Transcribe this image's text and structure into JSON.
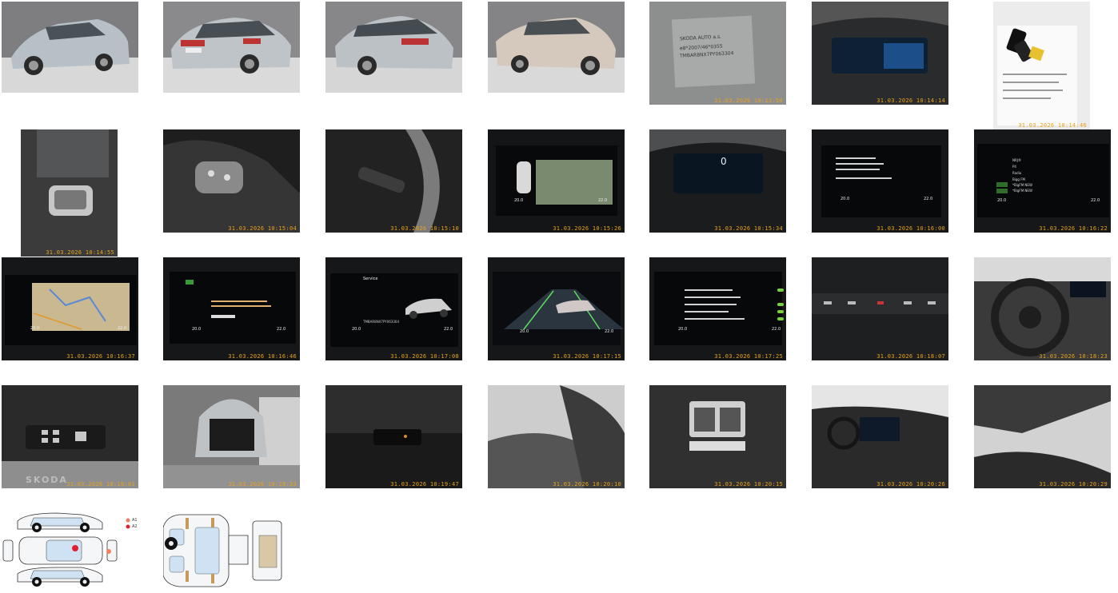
{
  "gallery": {
    "photos": [
      {
        "name": "exterior-front-left-photo",
        "stamp": ""
      },
      {
        "name": "exterior-rear-left-photo",
        "stamp": ""
      },
      {
        "name": "exterior-rear-right-photo",
        "stamp": ""
      },
      {
        "name": "exterior-front-right-photo",
        "stamp": ""
      },
      {
        "name": "vin-plate-photo",
        "stamp": "31.03.2026 10:13:50",
        "plate_text": [
          "SKODA AUTO a.s.",
          "e8*2007/46*0355",
          "TMBAR8NX7PY063304"
        ]
      },
      {
        "name": "digital-cockpit-photo",
        "stamp": "31.03.2026 10:14:14"
      },
      {
        "name": "keys-and-documents-photo",
        "stamp": "31.03.2026 10:14:46"
      },
      {
        "name": "gear-selector-photo",
        "stamp": "31.03.2026 10:14:55"
      },
      {
        "name": "steering-wheel-buttons-photo",
        "stamp": "31.03.2026 10:15:04"
      },
      {
        "name": "stalk-controls-photo",
        "stamp": "31.03.2026 10:15:10"
      },
      {
        "name": "rear-camera-screen-photo",
        "stamp": "31.03.2026 10:15:26",
        "screen_temp_left": "20.0",
        "screen_temp_right": "22.0"
      },
      {
        "name": "instrument-cluster-photo",
        "stamp": "31.03.2026 10:15:34",
        "speed": "0"
      },
      {
        "name": "info-screen-photo",
        "stamp": "31.03.2026 10:16:00",
        "screen_temp_left": "20.0",
        "screen_temp_right": "22.0"
      },
      {
        "name": "radio-screen-photo",
        "stamp": "31.03.2026 10:16:22",
        "screen_temp_left": "20.0",
        "screen_temp_right": "22.0",
        "stations": [
          "NRJ®",
          "P4",
          "Radio",
          "Bigg FM",
          "*BigFM NEW",
          "*BigFM NEW"
        ]
      },
      {
        "name": "navigation-screen-photo",
        "stamp": "31.03.2026 10:16:37",
        "screen_temp_left": "20.0",
        "screen_temp_right": "22.0"
      },
      {
        "name": "smartlink-screen-photo",
        "stamp": "31.03.2026 10:16:46",
        "screen_temp_left": "20.0",
        "screen_temp_right": "22.0"
      },
      {
        "name": "service-screen-photo",
        "stamp": "31.03.2026 10:17:08",
        "screen_temp_left": "20.0",
        "screen_temp_right": "22.0",
        "screen_title": "Service",
        "vin": "TMBAR8NX7PY063304"
      },
      {
        "name": "assist-screen-photo",
        "stamp": "31.03.2026 10:17:15",
        "screen_temp_left": "20.0",
        "screen_temp_right": "22.0"
      },
      {
        "name": "driver-assist-settings-photo",
        "stamp": "31.03.2026 10:17:25",
        "screen_temp_left": "20.0",
        "screen_temp_right": "22.0"
      },
      {
        "name": "climate-panel-photo",
        "stamp": "31.03.2026 10:18:07"
      },
      {
        "name": "dashboard-overview-photo",
        "stamp": "31.03.2026 10:18:23"
      },
      {
        "name": "door-panel-photo",
        "stamp": "31.03.2026 10:19:01",
        "sill_text": "SKODA"
      },
      {
        "name": "trunk-open-photo",
        "stamp": "31.03.2026 10:19:33"
      },
      {
        "name": "lower-console-photo",
        "stamp": "31.03.2026 10:19:47"
      },
      {
        "name": "rear-seats-photo",
        "stamp": "31.03.2026 10:20:10"
      },
      {
        "name": "rear-vents-photo",
        "stamp": "31.03.2026 10:20:15"
      },
      {
        "name": "interior-front-photo",
        "stamp": "31.03.2026 10:20:26"
      },
      {
        "name": "headliner-photo",
        "stamp": "31.03.2026 10:20:29"
      }
    ],
    "diagrams": [
      {
        "name": "exterior-damage-diagram",
        "legend": [
          "A1",
          "A2"
        ],
        "legend_colors": [
          "#f08060",
          "#e02030"
        ]
      },
      {
        "name": "interior-damage-diagram"
      }
    ]
  }
}
